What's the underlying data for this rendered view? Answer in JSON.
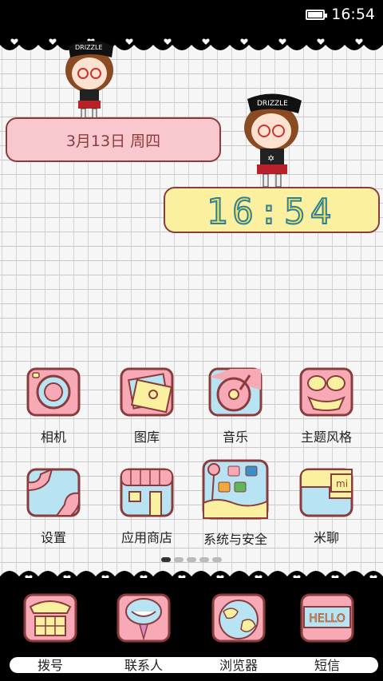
{
  "status_bar": {
    "time": "16:54"
  },
  "widgets": {
    "date_text": "3月13日 周四",
    "clock_time": "16:54"
  },
  "characters": {
    "cap_text": "DRIZZLE"
  },
  "apps": [
    {
      "label": "相机",
      "icon": "camera-icon"
    },
    {
      "label": "图库",
      "icon": "gallery-icon"
    },
    {
      "label": "音乐",
      "icon": "music-icon"
    },
    {
      "label": "主题风格",
      "icon": "theme-icon"
    },
    {
      "label": "设置",
      "icon": "settings-icon"
    },
    {
      "label": "应用商店",
      "icon": "app-store-icon"
    },
    {
      "label": "系统与安全",
      "icon": "system-security-icon"
    },
    {
      "label": "米聊",
      "icon": "mitalk-icon"
    }
  ],
  "dock": [
    {
      "label": "拨号",
      "icon": "phone-icon"
    },
    {
      "label": "联系人",
      "icon": "contacts-icon"
    },
    {
      "label": "浏览器",
      "icon": "browser-icon"
    },
    {
      "label": "短信",
      "icon": "messages-icon",
      "icon_text": "HELLO"
    }
  ],
  "mitalk_badge": "mi",
  "colors": {
    "pink": "#f9c8cf",
    "yellow": "#faf0a0",
    "blue": "#b8e3f2",
    "outline": "#8a3c3c"
  }
}
